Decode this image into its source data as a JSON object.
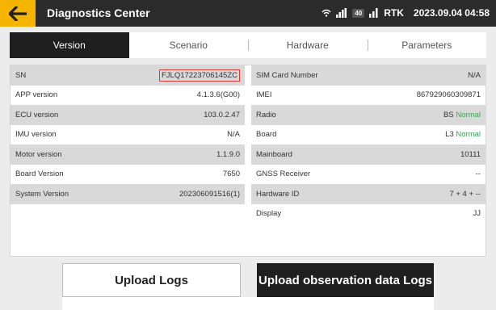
{
  "header": {
    "title": "Diagnostics Center",
    "signal_badge": "40",
    "rtk_label": "RTK",
    "datetime": "2023.09.04 04:58",
    "accent_color": "#f4b400"
  },
  "tabs": [
    {
      "label": "Version",
      "active": true
    },
    {
      "label": "Scenario",
      "active": false
    },
    {
      "label": "Hardware",
      "active": false
    },
    {
      "label": "Parameters",
      "active": false
    }
  ],
  "left_rows": [
    {
      "label": "SN",
      "value": "FJLQ17223706145ZC"
    },
    {
      "label": "APP version",
      "value": "4.1.3.6(G00)"
    },
    {
      "label": "ECU version",
      "value": "103.0.2.47"
    },
    {
      "label": "IMU version",
      "value": "N/A"
    },
    {
      "label": "Motor version",
      "value": "1.1.9.0"
    },
    {
      "label": "Board Version",
      "value": "7650"
    },
    {
      "label": "System Version",
      "value": "202306091516(1)"
    }
  ],
  "right_rows": [
    {
      "label": "SIM Card Number",
      "value": "N/A"
    },
    {
      "label": "IMEI",
      "value": "867929060309871"
    },
    {
      "label": "Radio",
      "prefix": "BS",
      "status": "Normal"
    },
    {
      "label": "Board",
      "prefix": "L3",
      "status": "Normal"
    },
    {
      "label": "Mainboard",
      "value": "10111"
    },
    {
      "label": "GNSS Receiver",
      "value": "--"
    },
    {
      "label": "Hardware ID",
      "value": "7 + 4 + --"
    },
    {
      "label": "Display",
      "value": "JJ"
    }
  ],
  "buttons": {
    "upload_logs": "Upload Logs",
    "upload_observation": "Upload observation data Logs"
  }
}
